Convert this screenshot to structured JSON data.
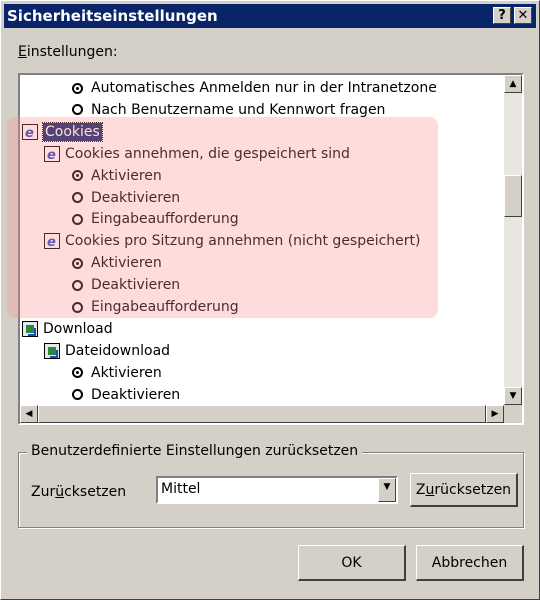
{
  "window": {
    "title": "Sicherheitseinstellungen",
    "help_button": "?",
    "close_button": "✕"
  },
  "settings_label_first": "E",
  "settings_label_rest": "instellungen:",
  "tree": [
    {
      "kind": "radio",
      "selected": true,
      "label": "Automatisches Anmelden nur in der Intranetzone"
    },
    {
      "kind": "radio",
      "selected": false,
      "label": "Nach Benutzername und Kennwort fragen"
    },
    {
      "kind": "category",
      "icon": "ie-settings-icon",
      "label": "Cookies",
      "selected": true
    },
    {
      "kind": "subcategory",
      "icon": "ie-settings-icon",
      "label": "Cookies annehmen, die gespeichert sind"
    },
    {
      "kind": "radio",
      "selected": true,
      "label": "Aktivieren"
    },
    {
      "kind": "radio",
      "selected": false,
      "label": "Deaktivieren"
    },
    {
      "kind": "radio",
      "selected": false,
      "label": "Eingabeaufforderung"
    },
    {
      "kind": "subcategory",
      "icon": "ie-settings-icon",
      "label": "Cookies pro Sitzung annehmen (nicht gespeichert)"
    },
    {
      "kind": "radio",
      "selected": true,
      "label": "Aktivieren"
    },
    {
      "kind": "radio",
      "selected": false,
      "label": "Deaktivieren"
    },
    {
      "kind": "radio",
      "selected": false,
      "label": "Eingabeaufforderung"
    },
    {
      "kind": "category",
      "icon": "download-icon",
      "label": "Download",
      "selected": false
    },
    {
      "kind": "subcategory",
      "icon": "download-icon",
      "label": "Dateidownload"
    },
    {
      "kind": "radio",
      "selected": true,
      "label": "Aktivieren"
    },
    {
      "kind": "radio",
      "selected": false,
      "label": "Deaktivieren"
    }
  ],
  "reset_group": {
    "legend": "Benutzerdefinierte Einstellungen zurücksetzen",
    "label_first": "Zur",
    "label_acc": "ü",
    "label_rest": "cksetzen",
    "select_value": "Mittel",
    "button_first": "Z",
    "button_acc": "u",
    "button_rest": "rücksetzen"
  },
  "buttons": {
    "ok": "OK",
    "cancel": "Abbrechen"
  }
}
